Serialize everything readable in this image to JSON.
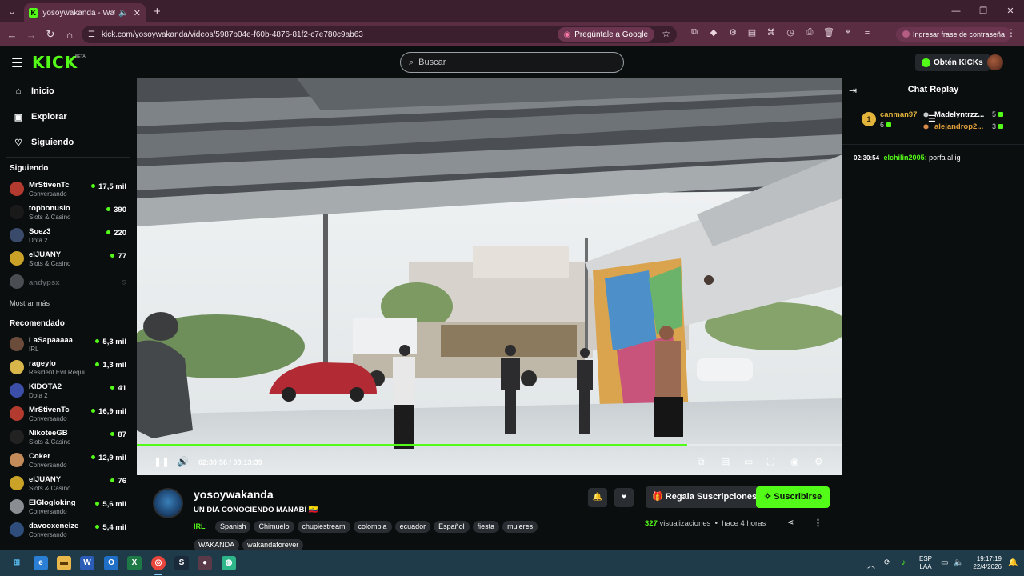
{
  "browser": {
    "tab_title": "yosoywakanda - Watch the",
    "url": "kick.com/yosoywakanda/videos/5987b04e-f60b-4876-81f2-c7e780c9ab63",
    "ask_google": "Pregúntale a Google",
    "passphrase": "Ingresar frase de contraseña"
  },
  "header": {
    "logo": "KICK",
    "beta": "BETA",
    "search_placeholder": "Buscar",
    "kicks_button": "Obtén KICKs"
  },
  "sidebar": {
    "nav": [
      {
        "label": "Inicio",
        "icon": "home-icon"
      },
      {
        "label": "Explorar",
        "icon": "compass-icon"
      },
      {
        "label": "Siguiendo",
        "icon": "heart-icon"
      }
    ],
    "following_title": "Siguiendo",
    "following": [
      {
        "name": "MrStivenTc",
        "category": "Conversando",
        "viewers": "17,5 mil",
        "color": "#b33a2e"
      },
      {
        "name": "topbonusio",
        "category": "Slots & Casino",
        "viewers": "390",
        "color": "#1a1a1a"
      },
      {
        "name": "Soez3",
        "category": "Dota 2",
        "viewers": "220",
        "color": "#3a4a6b"
      },
      {
        "name": "elJUANY",
        "category": "Slots & Casino",
        "viewers": "77",
        "color": "#c9a227"
      },
      {
        "name": "andypsx",
        "category": "",
        "viewers": "",
        "color": "#4a4d52",
        "offline": true
      }
    ],
    "show_more": "Mostrar más",
    "recommended_title": "Recomendado",
    "recommended": [
      {
        "name": "LaSapaaaaa",
        "category": "IRL",
        "viewers": "5,3 mil",
        "color": "#6b4b3a"
      },
      {
        "name": "rageylo",
        "category": "Resident Evil Requi...",
        "viewers": "1,3 mil",
        "color": "#d9b64a"
      },
      {
        "name": "KIDOTA2",
        "category": "Dota 2",
        "viewers": "41",
        "color": "#3c4fa8"
      },
      {
        "name": "MrStivenTc",
        "category": "Conversando",
        "viewers": "16,9 mil",
        "color": "#b33a2e"
      },
      {
        "name": "NikoteeGB",
        "category": "Slots & Casino",
        "viewers": "87",
        "color": "#222"
      },
      {
        "name": "Coker",
        "category": "Conversando",
        "viewers": "12,9 mil",
        "color": "#c38a5a"
      },
      {
        "name": "elJUANY",
        "category": "Slots & Casino",
        "viewers": "76",
        "color": "#c9a227"
      },
      {
        "name": "ElGlogloking",
        "category": "Conversando",
        "viewers": "5,6 mil",
        "color": "#8a8d92"
      },
      {
        "name": "davooxeneize",
        "category": "Conversando",
        "viewers": "5,4 mil",
        "color": "#2f4d7a"
      }
    ]
  },
  "player": {
    "time_current": "02:30:56",
    "time_total": "03:13:39",
    "progress": 0.78
  },
  "chat": {
    "title": "Chat Replay",
    "leaders": [
      {
        "name": "canman97",
        "count": "6"
      },
      {
        "name": "Madelyntrzz...",
        "count": "5"
      },
      {
        "name": "alejandrop2...",
        "count": "3"
      }
    ],
    "rank_badge": "1",
    "message": {
      "time": "02:30:54",
      "user": "elchilin2005:",
      "text": "porfa al ig"
    }
  },
  "stream": {
    "streamer": "yosoywakanda",
    "title": "UN DÍA CONOCIENDO MANABÍ 🇪🇨",
    "category": "IRL",
    "tags": [
      "Spanish",
      "Chimuelo",
      "chupiestream",
      "colombia",
      "ecuador",
      "Español",
      "fiesta",
      "mujeres",
      "WAKANDA",
      "wakandaforever"
    ],
    "gift_label": "Regala Suscripciones",
    "subscribe_label": "Suscribirse",
    "views_count": "327",
    "views_label": "visualizaciones",
    "ago": "hace 4 horas"
  },
  "taskbar": {
    "lang_line1": "ESP",
    "lang_line2": "LAA",
    "time": "19:17:19",
    "date": "22/4/2026"
  },
  "colors": {
    "accent": "#53fc18",
    "chrome": "#5a2d43"
  }
}
